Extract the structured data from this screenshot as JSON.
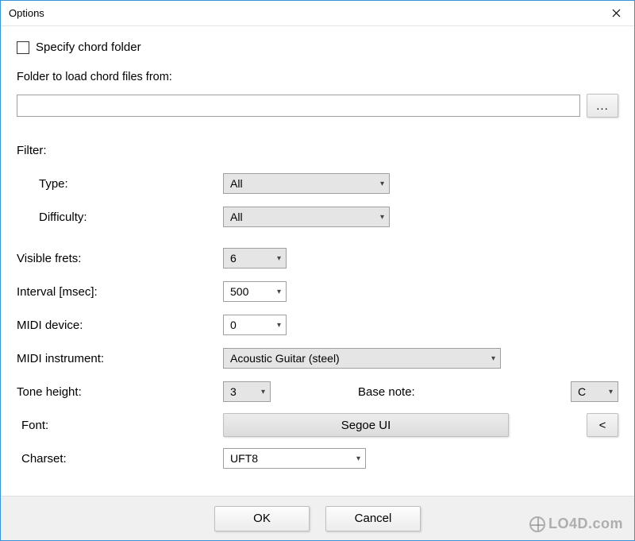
{
  "window": {
    "title": "Options"
  },
  "specify_chord": {
    "checkbox_label": "Specify chord folder",
    "checked": false,
    "folder_label": "Folder to load chord files from:",
    "folder_value": "",
    "browse_label": "..."
  },
  "filter": {
    "heading": "Filter:",
    "type_label": "Type:",
    "type_value": "All",
    "difficulty_label": "Difficulty:",
    "difficulty_value": "All"
  },
  "visible_frets": {
    "label": "Visible frets:",
    "value": "6"
  },
  "interval": {
    "label": "Interval [msec]:",
    "value": "500"
  },
  "midi_device": {
    "label": "MIDI device:",
    "value": "0"
  },
  "midi_instrument": {
    "label": "MIDI instrument:",
    "value": "Acoustic Guitar (steel)"
  },
  "tone_height": {
    "label": "Tone height:",
    "value": "3"
  },
  "base_note": {
    "label": "Base note:",
    "value": "C"
  },
  "font": {
    "label": "Font:",
    "value": "Segoe UI",
    "reset_label": "<"
  },
  "charset": {
    "label": "Charset:",
    "value": "UFT8"
  },
  "buttons": {
    "ok": "OK",
    "cancel": "Cancel"
  },
  "watermark": "LO4D.com"
}
